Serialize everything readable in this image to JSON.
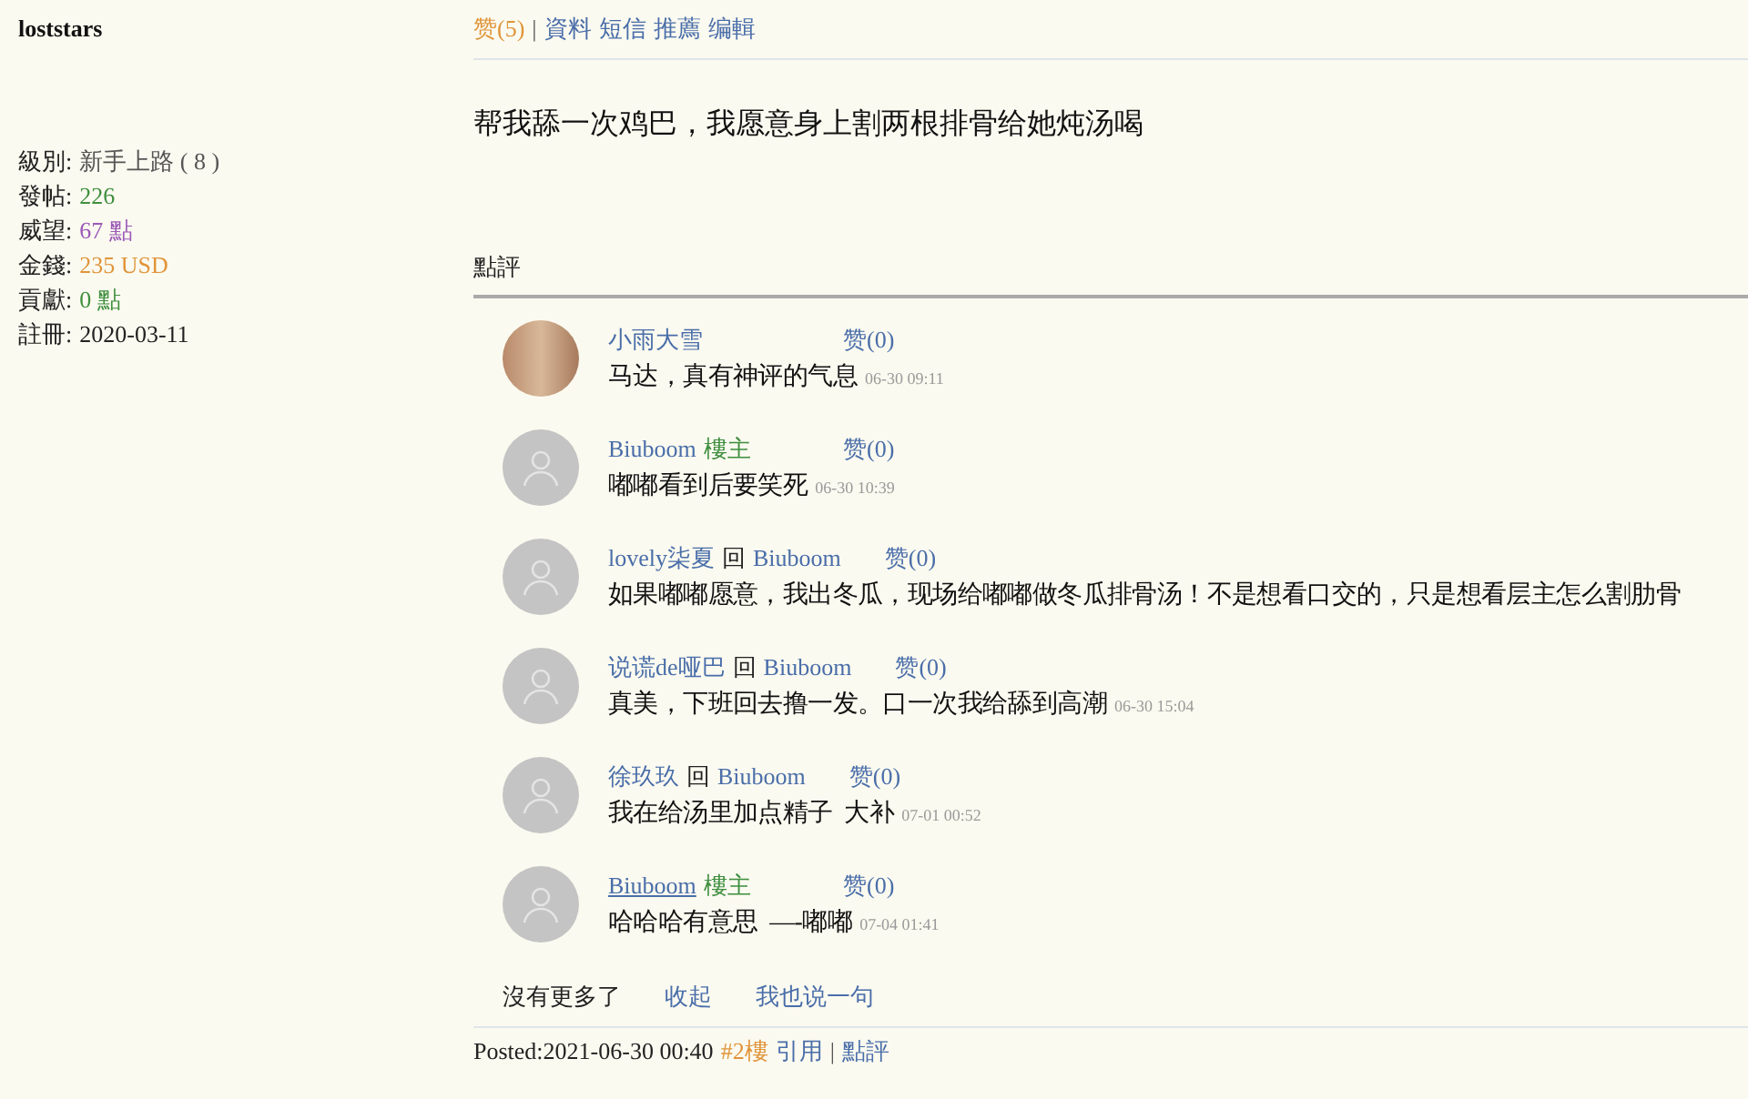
{
  "profile": {
    "username": "loststars",
    "stats": [
      {
        "label": "級別:",
        "value": "新手上路 ( 8 )",
        "color": "#555555"
      },
      {
        "label": "發帖:",
        "value": "226",
        "color": "#3f8f3f"
      },
      {
        "label": "威望:",
        "value": "67 點",
        "color": "#9b59b6"
      },
      {
        "label": "金錢:",
        "value": "235 USD",
        "color": "#e0953a"
      },
      {
        "label": "貢獻:",
        "value": "0 點",
        "color": "#3f8f3f"
      },
      {
        "label": "註冊:",
        "value": "2020-03-11",
        "color": "#222222"
      }
    ]
  },
  "post_actions": {
    "like": "赞(5)",
    "separator": "|",
    "links": [
      "資料",
      "短信",
      "推薦",
      "编輯"
    ]
  },
  "post_text": "帮我舔一次鸡巴，我愿意身上割两根排骨给她炖汤喝",
  "comments_heading": "點評",
  "comments": [
    {
      "kind": "photo",
      "user": "小雨大雪",
      "underlined": false,
      "likes": "赞(0)",
      "text": "马达，真有神评的气息",
      "time": "06-30 09:11"
    },
    {
      "kind": "default",
      "user": "Biuboom",
      "badge": "樓主",
      "underlined": false,
      "likes": "赞(0)",
      "text": "嘟嘟看到后要笑死",
      "time": "06-30 10:39"
    },
    {
      "kind": "default",
      "user": "lovely柒夏",
      "reply_word": "回",
      "reply_to": "Biuboom",
      "underlined": false,
      "likes": "赞(0)",
      "text": "如果嘟嘟愿意，我出冬瓜，现场给嘟嘟做冬瓜排骨汤！不是想看口交的，只是想看层主怎么割肋骨"
    },
    {
      "kind": "default",
      "user": "说谎de哑巴",
      "reply_word": "回",
      "reply_to": "Biuboom",
      "underlined": false,
      "likes": "赞(0)",
      "text": "真美，下班回去撸一发。口一次我给舔到高潮",
      "time": "06-30 15:04"
    },
    {
      "kind": "default",
      "user": "徐玖玖",
      "reply_word": "回",
      "reply_to": "Biuboom",
      "underlined": false,
      "likes": "赞(0)",
      "text": "我在给汤里加点精子  大补",
      "time": "07-01 00:52"
    },
    {
      "kind": "default",
      "user": "Biuboom",
      "badge": "樓主",
      "underlined": true,
      "likes": "赞(0)",
      "text": "哈哈哈有意思  —-嘟嘟",
      "time": "07-04 01:41"
    }
  ],
  "comments_footer": {
    "status": "沒有更多了",
    "links": [
      "收起",
      "我也说一句"
    ]
  },
  "next_post": {
    "posted": "Posted:2021-06-30 00:40",
    "floor": "#2樓",
    "quote": "引用",
    "separator": "|",
    "review": "點評"
  }
}
